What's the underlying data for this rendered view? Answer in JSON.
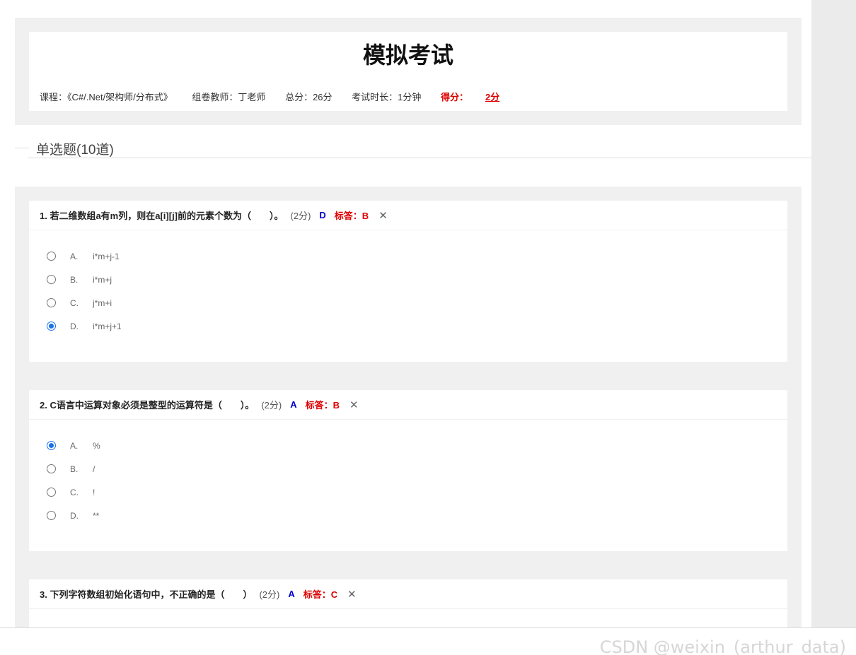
{
  "exam": {
    "title": "模拟考试",
    "course": "课程：《C#/.Net/架构师/分布式》",
    "teacher": "组卷教师：丁老师",
    "total": "总分：26分",
    "duration": "考试时长：1分钟",
    "score_label": "得分：",
    "score_value": "2分"
  },
  "section": {
    "title": "单选题(10道)"
  },
  "questions": [
    {
      "text": "1. 若二维数组a有m列，则在a[i][j]前的元素个数为（　　）。",
      "points": "(2分)",
      "user_answer": "D",
      "std_answer": "标答：B",
      "wrong_mark": "✕",
      "options": [
        {
          "letter": "A.",
          "text": "i*m+j-1",
          "selected": false
        },
        {
          "letter": "B.",
          "text": "i*m+j",
          "selected": false
        },
        {
          "letter": "C.",
          "text": "j*m+i",
          "selected": false
        },
        {
          "letter": "D.",
          "text": "i*m+j+1",
          "selected": true
        }
      ]
    },
    {
      "text": "2. C语言中运算对象必须是整型的运算符是（　　）。",
      "points": "(2分)",
      "user_answer": "A",
      "std_answer": "标答：B",
      "wrong_mark": "✕",
      "options": [
        {
          "letter": "A.",
          "text": "%",
          "selected": true
        },
        {
          "letter": "B.",
          "text": "/",
          "selected": false
        },
        {
          "letter": "C.",
          "text": "!",
          "selected": false
        },
        {
          "letter": "D.",
          "text": "**",
          "selected": false
        }
      ]
    },
    {
      "text": "3. 下列字符数组初始化语句中，不正确的是（　　）",
      "points": "(2分)",
      "user_answer": "A",
      "std_answer": "标答：C",
      "wrong_mark": "✕"
    }
  ],
  "watermark": "CSDN @weixin_(arthur_data)",
  "colors": {
    "user_answer": "#0000cc",
    "std_answer": "#dd0000",
    "radio_selected": "#1a73e8",
    "panel_bg": "#f0f0f0"
  },
  "icons": {
    "wrong_mark": "close-icon"
  }
}
